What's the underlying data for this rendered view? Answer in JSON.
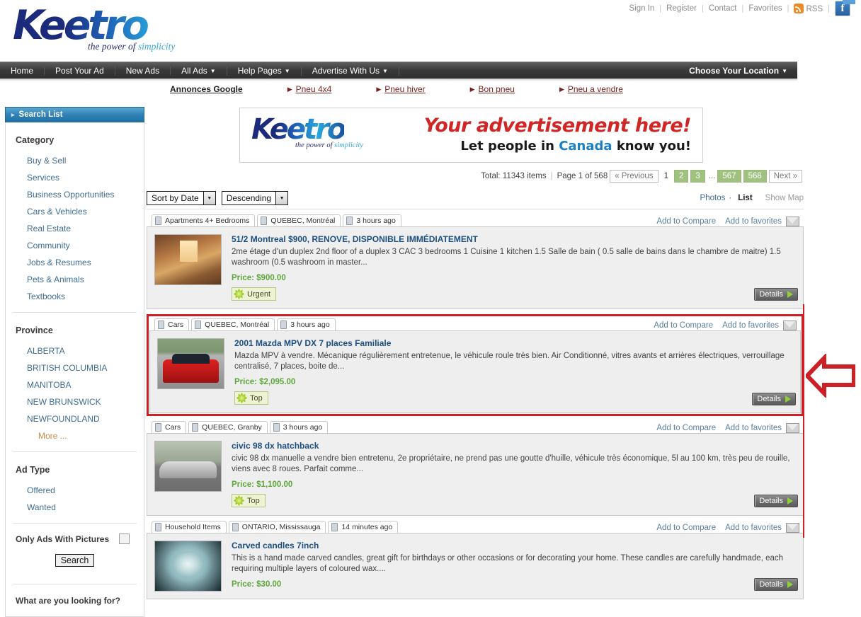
{
  "utility": {
    "links": [
      "Sign In",
      "Register",
      "Contact",
      "Favorites"
    ],
    "rss_label": "RSS",
    "facebook_label": "f",
    "separator": "|"
  },
  "logo": {
    "wordmark": "Keetro",
    "tagline_a": "the power of ",
    "tagline_b": "simplicity"
  },
  "nav": {
    "items": [
      {
        "label": "Home",
        "caret": false
      },
      {
        "label": "Post Your Ad",
        "caret": false
      },
      {
        "label": "New Ads",
        "caret": false
      },
      {
        "label": "All Ads",
        "caret": true
      },
      {
        "label": "Help Pages",
        "caret": true
      },
      {
        "label": "Advertise With Us",
        "caret": true
      }
    ],
    "location_label": "Choose Your Location",
    "caret_glyph": "▼"
  },
  "adstrip": {
    "label": "Annonces Google",
    "links": [
      "Pneu 4x4",
      "Pneu hiver",
      "Bon pneu",
      "Pneu a vendre"
    ]
  },
  "sidebar": {
    "header": "Search List",
    "category_title": "Category",
    "categories": [
      "Buy & Sell",
      "Services",
      "Business Opportunities",
      "Cars & Vehicles",
      "Real Estate",
      "Community",
      "Jobs & Resumes",
      "Pets & Animals",
      "Textbooks"
    ],
    "province_title": "Province",
    "provinces": [
      "ALBERTA",
      "BRITISH COLUMBIA",
      "MANITOBA",
      "NEW BRUNSWICK",
      "NEWFOUNDLAND"
    ],
    "province_more": "More ...",
    "adtype_title": "Ad Type",
    "adtypes": [
      "Offered",
      "Wanted"
    ],
    "only_pictures_label": "Only Ads With Pictures",
    "search_button": "Search",
    "looking_for_label": "What are you looking for?"
  },
  "banner": {
    "wordmark": "Keetro",
    "tagline_a": "the power of ",
    "tagline_b": "simplicity",
    "line1": "Your advertisement here!",
    "line2_a": "Let people in ",
    "line2_b": "Canada",
    "line2_c": " know you!"
  },
  "pager": {
    "total": "Total: 11343 items",
    "page_of": "Page 1 of 568",
    "previous": "« Previous",
    "current": "1",
    "pages": [
      "2",
      "3"
    ],
    "dots": "...",
    "far_pages": [
      "567",
      "568"
    ],
    "next": "Next »"
  },
  "toolbar": {
    "sort_field": "Sort by Date",
    "sort_dir": "Descending",
    "photos": "Photos",
    "dot": "·",
    "list": "List",
    "show_map": "Show Map",
    "arrow_glyph": "▼"
  },
  "row_actions": {
    "compare": "Add to Compare",
    "favorites": "Add to favorites"
  },
  "details_label": "Details",
  "listings": [
    {
      "tags": [
        "Apartments 4+ Bedrooms",
        "QUEBEC, Montréal",
        "3 hours ago"
      ],
      "title": "51/2 Montreal $900, RENOVE, DISPONIBLE IMMÉDIATEMENT",
      "desc": "2me étage d'un duplex 2nd floor of a duplex 3 CAC 3 bedrooms 1 Cuisine 1 kitchen 1.5 Salle de bain ( 0.5 salle de bains dans le chambre de maitre) 1.5 washroom (0.5 washroom in master...",
      "price": "Price: $900.00",
      "badge": "Urgent",
      "thumb_class": "t-apt",
      "highlighted": false
    },
    {
      "tags": [
        "Cars",
        "QUEBEC, Montréal",
        "3 hours ago"
      ],
      "title": "2001 Mazda MPV DX 7 places Familiale",
      "desc": "Mazda MPV à vendre. Mécanique régulièrement entretenue, le véhicule roule très bien. Air Conditionné, vitres avants et arrières électriques, verrouillage centralisé, 7 places, boite de...",
      "price": "Price: $2,095.00",
      "badge": "Top",
      "thumb_class": "t-car",
      "highlighted": true
    },
    {
      "tags": [
        "Cars",
        "QUEBEC, Granby",
        "3 hours ago"
      ],
      "title": "civic 98 dx hatchback",
      "desc": "civic 98 dx manuelle a vendre bien entretenu, 2e propriétaire, ne prend pas une goutte d'huille, véhicule très économique, 5l au 100 km, très peu de rouille, viens avec 8 roues. Parfait comme...",
      "price": "Price: $1,100.00",
      "badge": "Top",
      "thumb_class": "t-civic",
      "highlighted": false
    },
    {
      "tags": [
        "Household Items",
        "ONTARIO, Mississauga",
        "14 minutes ago"
      ],
      "title": "Carved candles 7inch",
      "desc": "This is a hand made carved candles, great gift for birthdays or other occasions or for decorating your home. These candles are carefully handmade, each requiring multiple layers of coloured wax....",
      "price": "Price: $30.00",
      "badge": "",
      "thumb_class": "t-candle",
      "highlighted": false
    }
  ],
  "annotation": {
    "arrow_color": "#cc2026",
    "highlight_color": "#cc2026"
  }
}
